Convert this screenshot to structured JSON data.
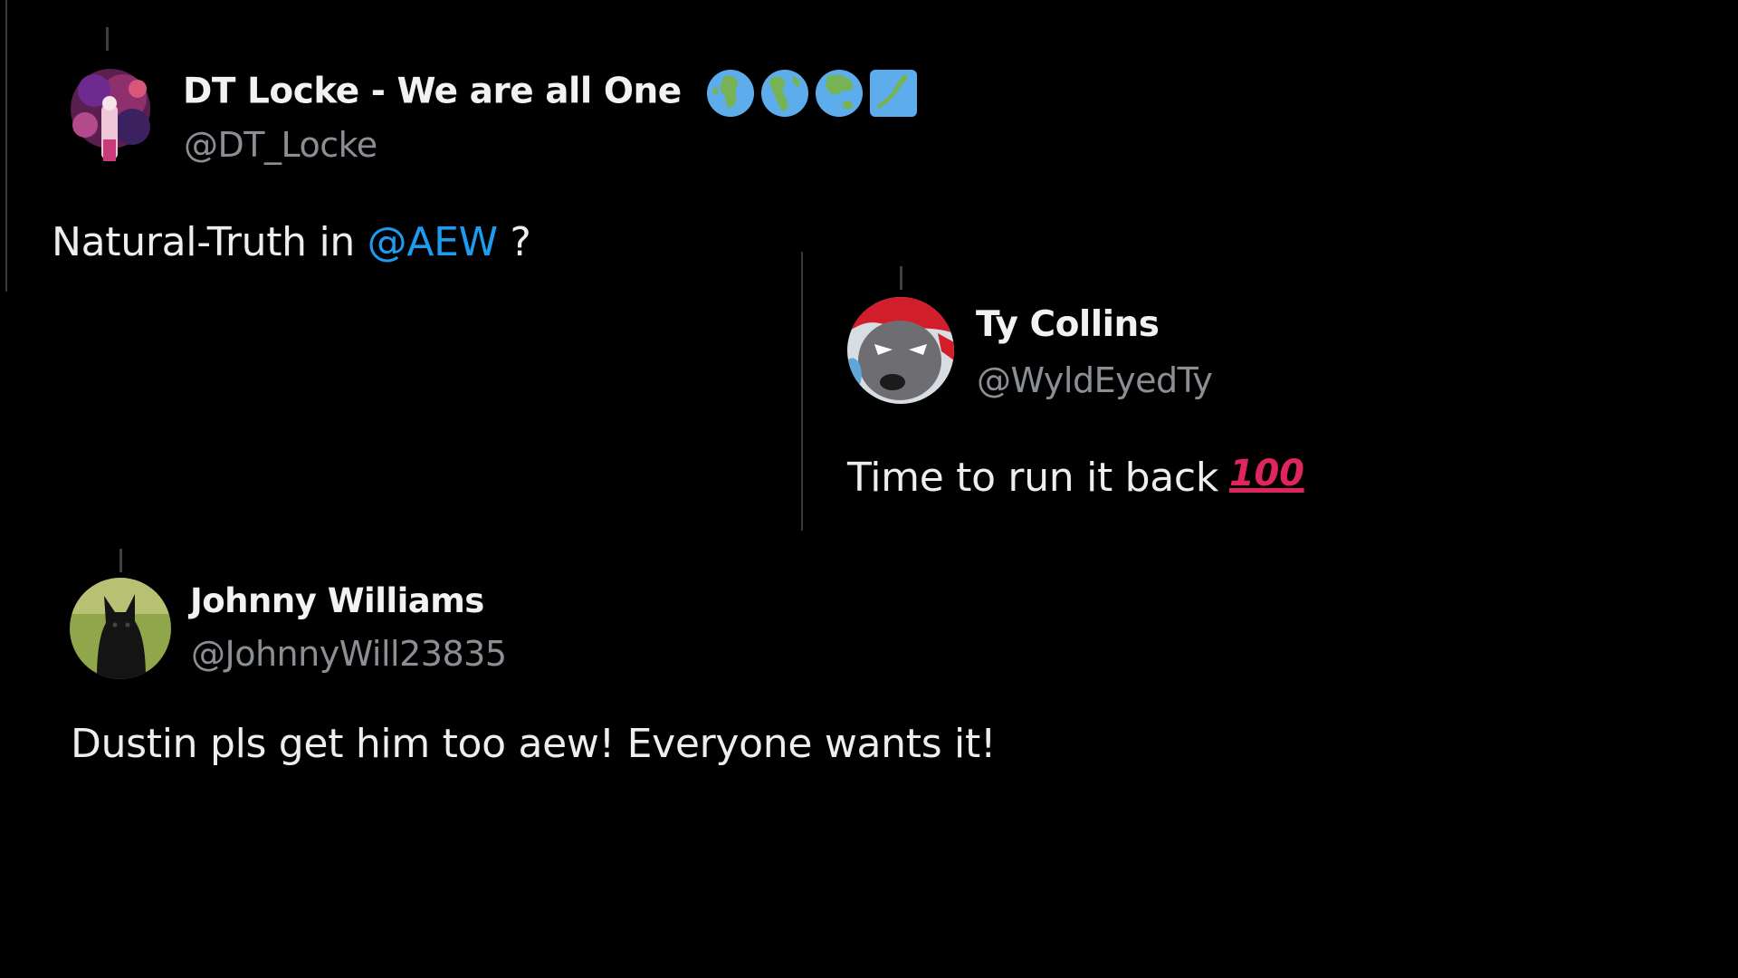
{
  "colors": {
    "background": "#000000",
    "text": "#eeeeee",
    "handle": "#8b8f94",
    "mention": "#1d9bf0",
    "thread_line": "#3a3a3a",
    "emoji_100": "#e0245e"
  },
  "tweets": [
    {
      "display_name": "DT Locke - We are all One",
      "name_emojis": [
        "globe-europe-africa-icon",
        "globe-americas-icon",
        "globe-asia-australia-icon",
        "map-of-japan-icon"
      ],
      "handle": "@DT_Locke",
      "text_before": "Natural-Truth in ",
      "mention": "@AEW",
      "text_after": " ?"
    },
    {
      "display_name": "Ty Collins",
      "handle": "@WyldEyedTy",
      "text": "Time to run it back",
      "emoji": "100",
      "emoji_icon": "hundred-points-icon"
    },
    {
      "display_name": "Johnny Williams",
      "handle": "@JohnnyWill23835",
      "text": "Dustin pls get him too aew! Everyone wants it!"
    }
  ]
}
